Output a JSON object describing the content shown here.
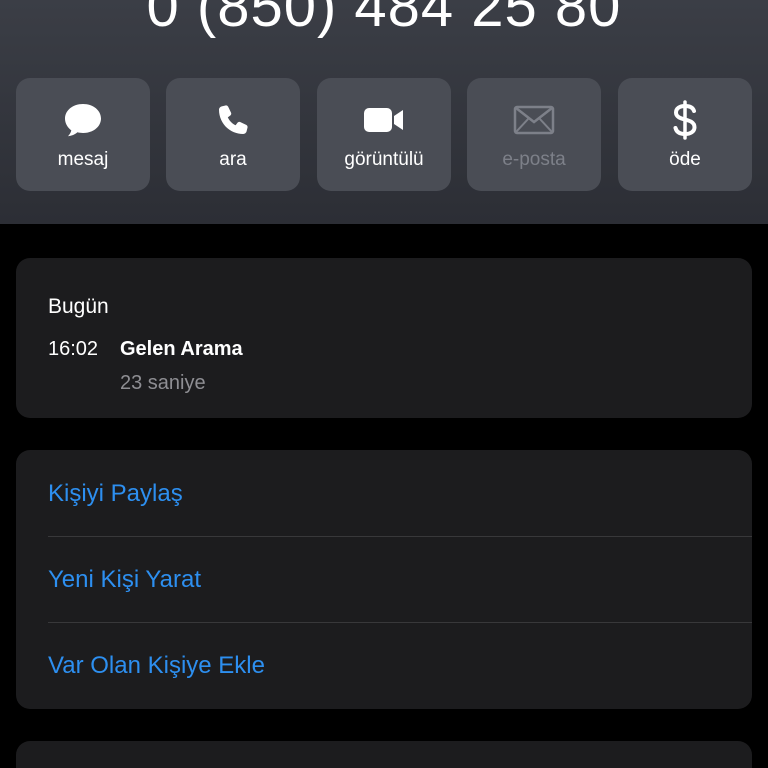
{
  "header": {
    "phone_number": "0 (850) 484 25 80"
  },
  "actions": [
    {
      "label": "mesaj",
      "icon": "message-bubble-icon",
      "enabled": true
    },
    {
      "label": "ara",
      "icon": "phone-icon",
      "enabled": true
    },
    {
      "label": "görüntülü",
      "icon": "video-camera-icon",
      "enabled": true
    },
    {
      "label": "e-posta",
      "icon": "envelope-icon",
      "enabled": false
    },
    {
      "label": "öde",
      "icon": "dollar-icon",
      "enabled": true
    }
  ],
  "recent": {
    "day": "Bugün",
    "time": "16:02",
    "type": "Gelen Arama",
    "duration": "23 saniye"
  },
  "options": [
    {
      "label": "Kişiyi Paylaş"
    },
    {
      "label": "Yeni Kişi Yarat"
    },
    {
      "label": "Var Olan Kişiye Ekle"
    }
  ],
  "colors": {
    "accent": "#2d8ff0",
    "background": "#000000",
    "card": "#1c1c1e",
    "action_button": "#4a4d55",
    "secondary_text": "#8e8e93"
  }
}
